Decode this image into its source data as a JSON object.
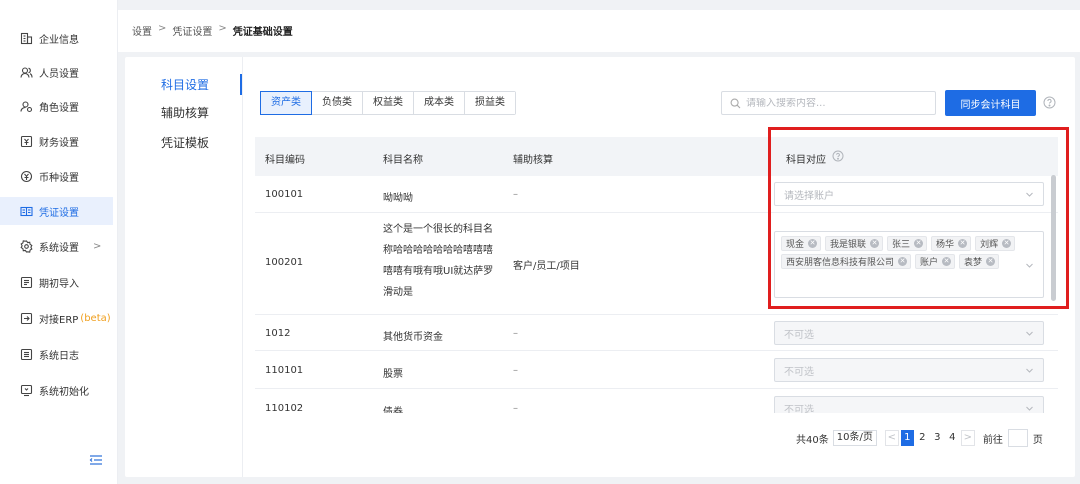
{
  "sidebar": {
    "items": [
      {
        "label": "企业信息",
        "icon": "building-icon"
      },
      {
        "label": "人员设置",
        "icon": "users-icon"
      },
      {
        "label": "角色设置",
        "icon": "role-icon"
      },
      {
        "label": "财务设置",
        "icon": "finance-icon"
      },
      {
        "label": "币种设置",
        "icon": "currency-icon"
      },
      {
        "label": "凭证设置",
        "icon": "voucher-icon"
      },
      {
        "label": "系统设置",
        "icon": "settings-icon"
      },
      {
        "label": "期初导入",
        "icon": "import-icon"
      },
      {
        "label": "对接ERP",
        "icon": "erp-icon",
        "tag": "(beta)"
      },
      {
        "label": "系统日志",
        "icon": "log-icon"
      },
      {
        "label": "系统初始化",
        "icon": "init-icon"
      }
    ],
    "arrow": ">"
  },
  "breadcrumb": {
    "items": [
      "设置",
      "凭证设置",
      "凭证基础设置"
    ],
    "separator": ">"
  },
  "subnav": {
    "items": [
      "科目设置",
      "辅助核算",
      "凭证模板"
    ]
  },
  "tabs": [
    "资产类",
    "负债类",
    "权益类",
    "成本类",
    "损益类"
  ],
  "search": {
    "placeholder": "请输入搜索内容..."
  },
  "sync_button": "同步会计科目",
  "table": {
    "headers": [
      "科目编码",
      "科目名称",
      "辅助核算",
      "科目对应"
    ],
    "rows": [
      {
        "code": "100101",
        "name": "呦呦呦",
        "aux": "–",
        "mapping": "请选择账户"
      },
      {
        "code": "100201",
        "name_lines": [
          "这个是一个很长的科目名",
          "称哈哈哈哈哈哈哈嘻嘻嘻",
          "嘻嘻有哦有哦UI就达萨罗",
          "滑动是"
        ],
        "aux": "客户/员工/项目"
      },
      {
        "code": "1012",
        "name": "其他货币资金",
        "aux": "–",
        "mapping": "不可选"
      },
      {
        "code": "110101",
        "name": "股票",
        "aux": "–",
        "mapping": "不可选"
      },
      {
        "code": "110102",
        "name": "债券",
        "aux": "–",
        "mapping": "不可选"
      }
    ],
    "chips": [
      "现金",
      "我是银联",
      "张三",
      "杨华",
      "刘辉",
      "西安朋客信息科技有限公司",
      "账户",
      "袁梦"
    ]
  },
  "pagination": {
    "total": "共40条",
    "page_size": "10条/页",
    "prev": "<",
    "pages": [
      "1",
      "2",
      "3",
      "4"
    ],
    "next": ">",
    "goto_label": "前往",
    "page_suffix": "页"
  },
  "colors": {
    "accent": "#1e6ce4",
    "highlight": "#e01e1e"
  }
}
